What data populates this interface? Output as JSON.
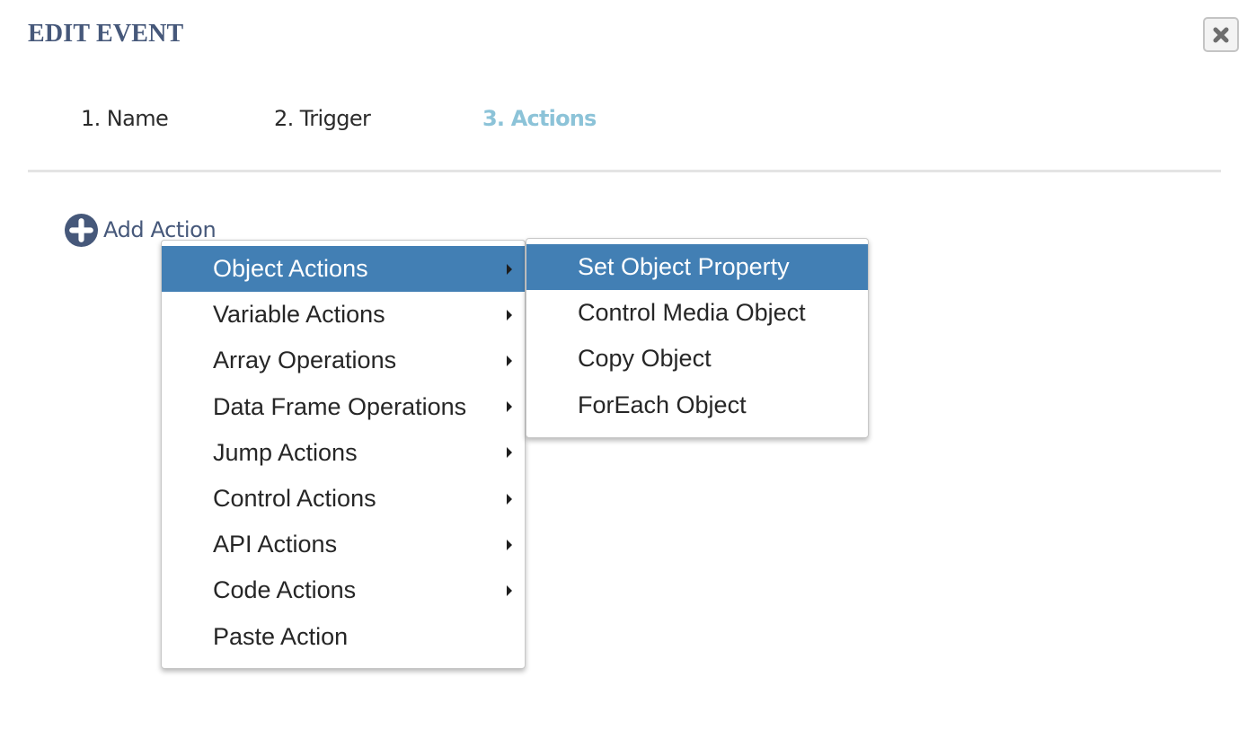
{
  "dialog": {
    "title": "EDIT EVENT",
    "close_icon": "close-x-icon"
  },
  "steps": [
    {
      "label": "1. Name",
      "active": false
    },
    {
      "label": "2. Trigger",
      "active": false
    },
    {
      "label": "3. Actions",
      "active": true
    }
  ],
  "add_action": {
    "label": "Add Action",
    "icon": "plus-circle-icon"
  },
  "main_menu": {
    "items": [
      {
        "label": "Object Actions",
        "has_submenu": true,
        "highlighted": true
      },
      {
        "label": "Variable Actions",
        "has_submenu": true,
        "highlighted": false
      },
      {
        "label": "Array Operations",
        "has_submenu": true,
        "highlighted": false
      },
      {
        "label": "Data Frame Operations",
        "has_submenu": true,
        "highlighted": false
      },
      {
        "label": "Jump Actions",
        "has_submenu": true,
        "highlighted": false
      },
      {
        "label": "Control Actions",
        "has_submenu": true,
        "highlighted": false
      },
      {
        "label": "API Actions",
        "has_submenu": true,
        "highlighted": false
      },
      {
        "label": "Code Actions",
        "has_submenu": true,
        "highlighted": false
      },
      {
        "label": "Paste Action",
        "has_submenu": false,
        "highlighted": false
      }
    ]
  },
  "sub_menu": {
    "parent": "Object Actions",
    "items": [
      {
        "label": "Set Object Property",
        "highlighted": true
      },
      {
        "label": "Control Media Object",
        "highlighted": false
      },
      {
        "label": "Copy Object",
        "highlighted": false
      },
      {
        "label": "ForEach Object",
        "highlighted": false
      }
    ]
  },
  "colors": {
    "title": "#46587a",
    "active_step": "#8cc3d8",
    "highlight": "#427fb4"
  }
}
